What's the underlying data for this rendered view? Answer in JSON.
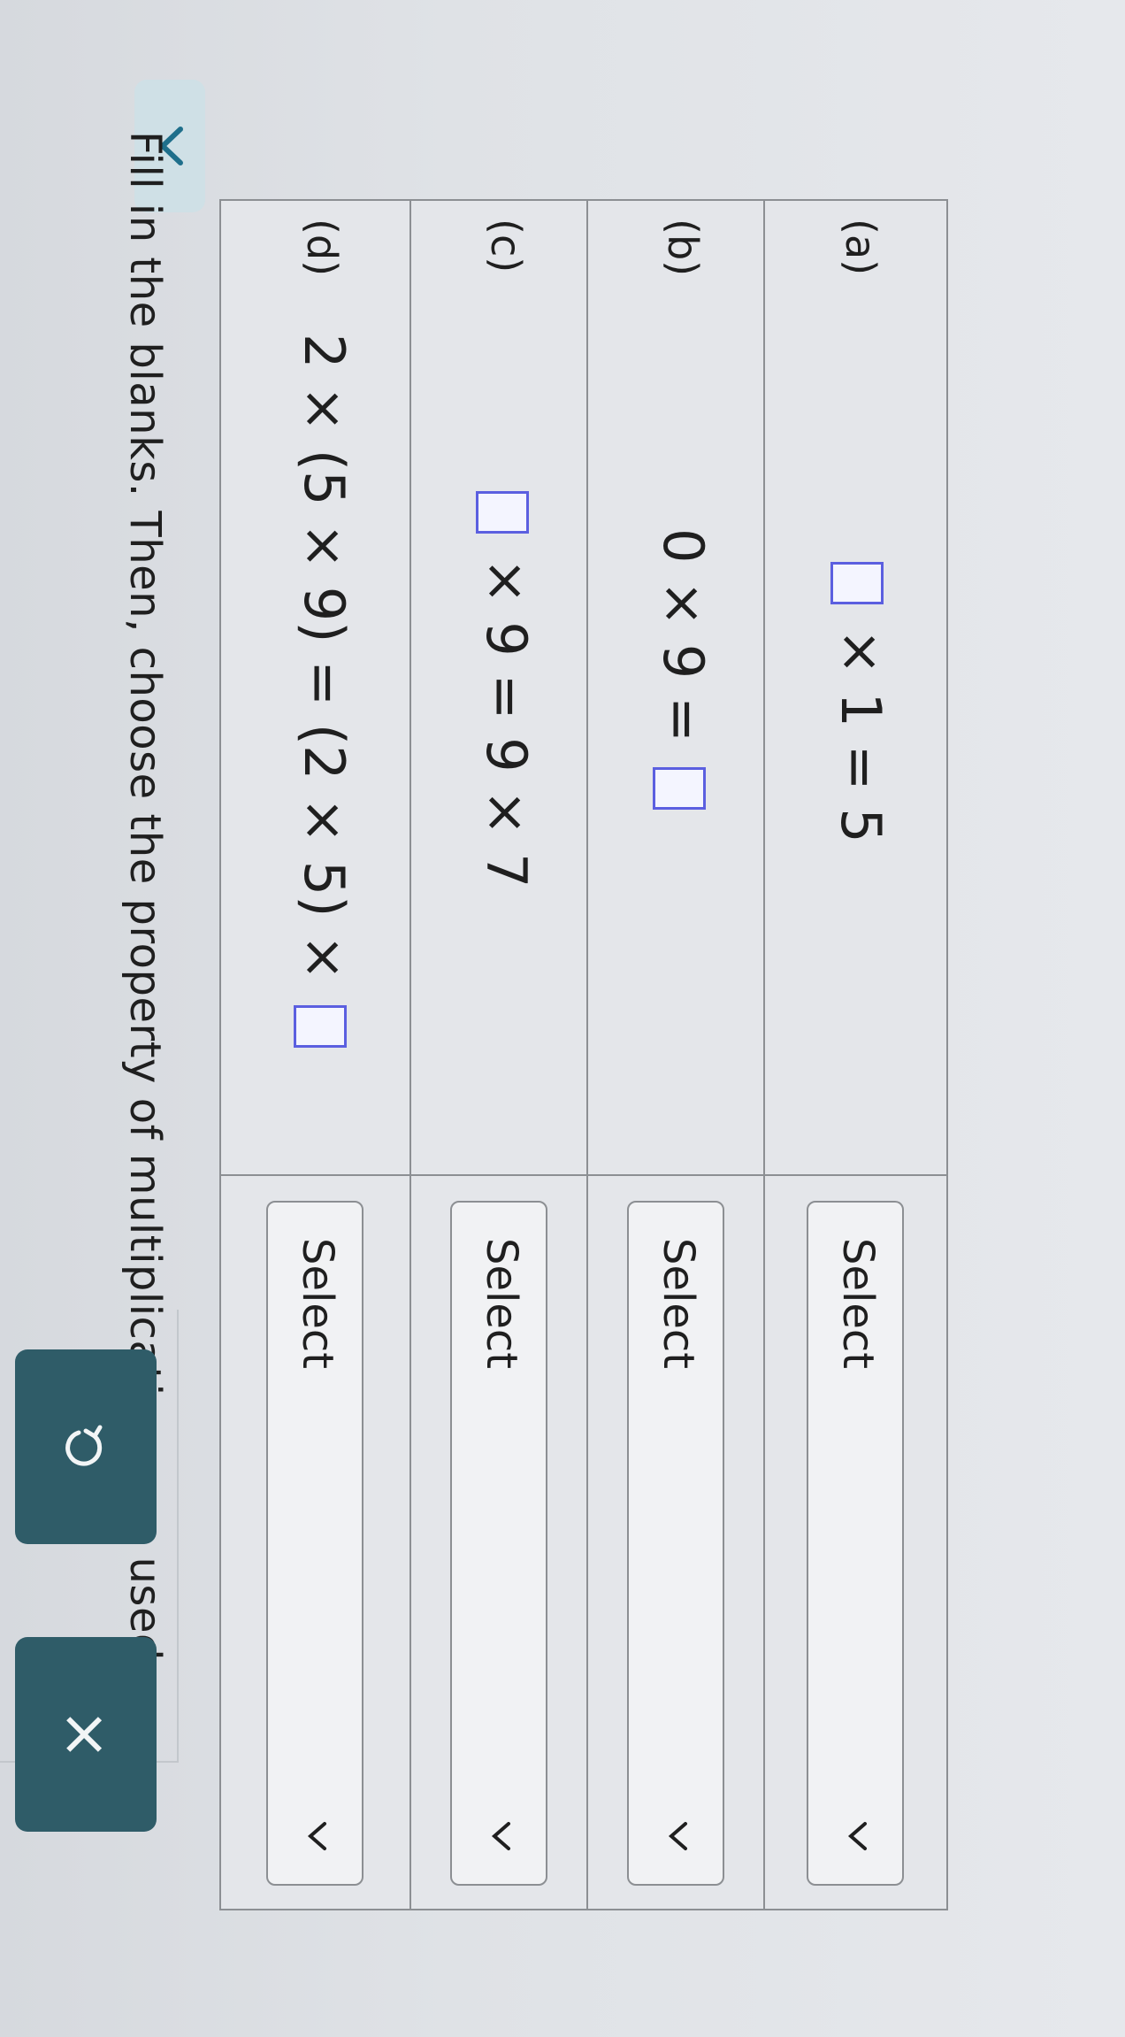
{
  "instructions": "Fill in the blanks. Then, choose the property of multiplication you used.",
  "rows": [
    {
      "label": "(a)",
      "expr_before": "",
      "expr_after": "× 1 = 5",
      "select_label": "Select"
    },
    {
      "label": "(b)",
      "expr_before": "0 × 9 =",
      "expr_after": "",
      "select_label": "Select"
    },
    {
      "label": "(c)",
      "expr_before": "",
      "expr_after": "× 9 = 9 × 7",
      "select_label": "Select"
    },
    {
      "label": "(d)",
      "expr_before": "2 × (5 × 9) = (2 × 5) ×",
      "expr_after": "",
      "select_label": "Select"
    }
  ],
  "buttons": {
    "undo_icon": "undo-icon",
    "clear_label": "×"
  },
  "colors": {
    "blank_border": "#5b5fe0",
    "button_bg": "#2f5c68"
  }
}
